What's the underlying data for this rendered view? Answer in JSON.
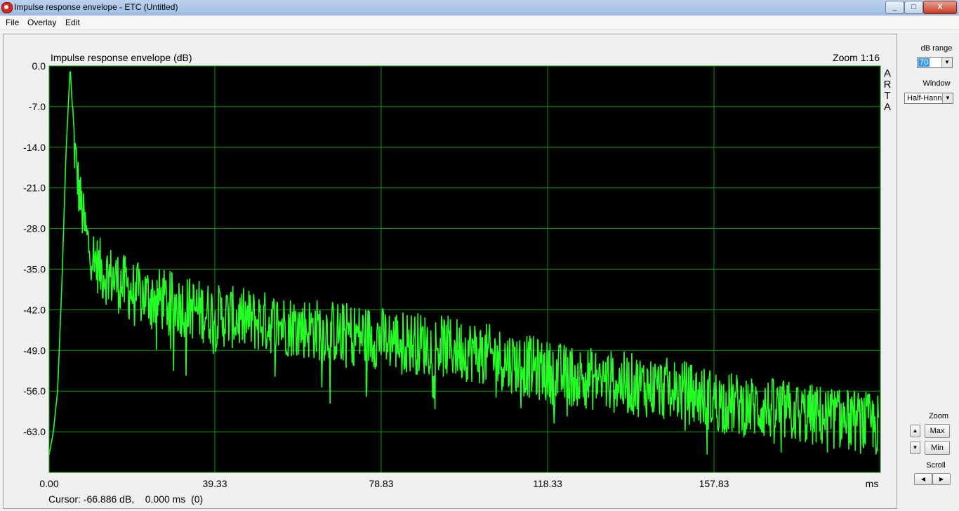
{
  "window": {
    "title": "Impulse response envelope - ETC (Untitled)",
    "min_glyph": "_",
    "max_glyph": "□",
    "close_glyph": "X"
  },
  "menu": [
    "File",
    "Overlay",
    "Edit"
  ],
  "plot": {
    "title": "Impulse response envelope (dB)",
    "zoom_label": "Zoom 1:16",
    "brand_letters": [
      "A",
      "R",
      "T",
      "A"
    ],
    "y_ticks": [
      "0.0",
      "-7.0",
      "-14.0",
      "-21.0",
      "-28.0",
      "-35.0",
      "-42.0",
      "-49.0",
      "-56.0",
      "-63.0"
    ],
    "x_ticks": [
      "0.00",
      "39.33",
      "78.83",
      "118.33",
      "157.83"
    ],
    "x_unit": "ms",
    "cursor_text": "Cursor: -66.886 dB,    0.000 ms  (0)",
    "background_color": "#000000",
    "grid_color": "#00a000",
    "trace_color": "#22ff22"
  },
  "chart_data": {
    "type": "line",
    "x_unit": "ms",
    "y_unit": "dB",
    "xlim": [
      0,
      197.33
    ],
    "ylim": [
      -70,
      0
    ],
    "series": [
      {
        "x": [
          0,
          1,
          2,
          3,
          4,
          5,
          6,
          7,
          8,
          9,
          10,
          12,
          14,
          16,
          18,
          20,
          25,
          30,
          35,
          40,
          50,
          60,
          70,
          80,
          90,
          100,
          110,
          120,
          130,
          140,
          150,
          160,
          170,
          180,
          190,
          197
        ],
        "y": [
          -67,
          -63,
          -56,
          -38,
          -15,
          0,
          -14,
          -21,
          -26,
          -30,
          -32,
          -35,
          -36,
          -37,
          -38,
          -39,
          -40,
          -41,
          -42,
          -43,
          -44,
          -45,
          -46,
          -47,
          -48,
          -49,
          -51,
          -53,
          -54,
          -55,
          -56,
          -58,
          -59,
          -60,
          -61,
          -62
        ]
      }
    ]
  },
  "side_panel": {
    "db_range_label": "dB range",
    "db_range_value": "70",
    "window_label": "Window",
    "window_value": "Half-Hann",
    "zoom_label": "Zoom",
    "max_label": "Max",
    "min_label": "Min",
    "scroll_label": "Scroll",
    "up_glyph": "▲",
    "down_glyph": "▼",
    "left_glyph": "◀",
    "right_glyph": "▶",
    "dropdown_glyph": "▼"
  }
}
